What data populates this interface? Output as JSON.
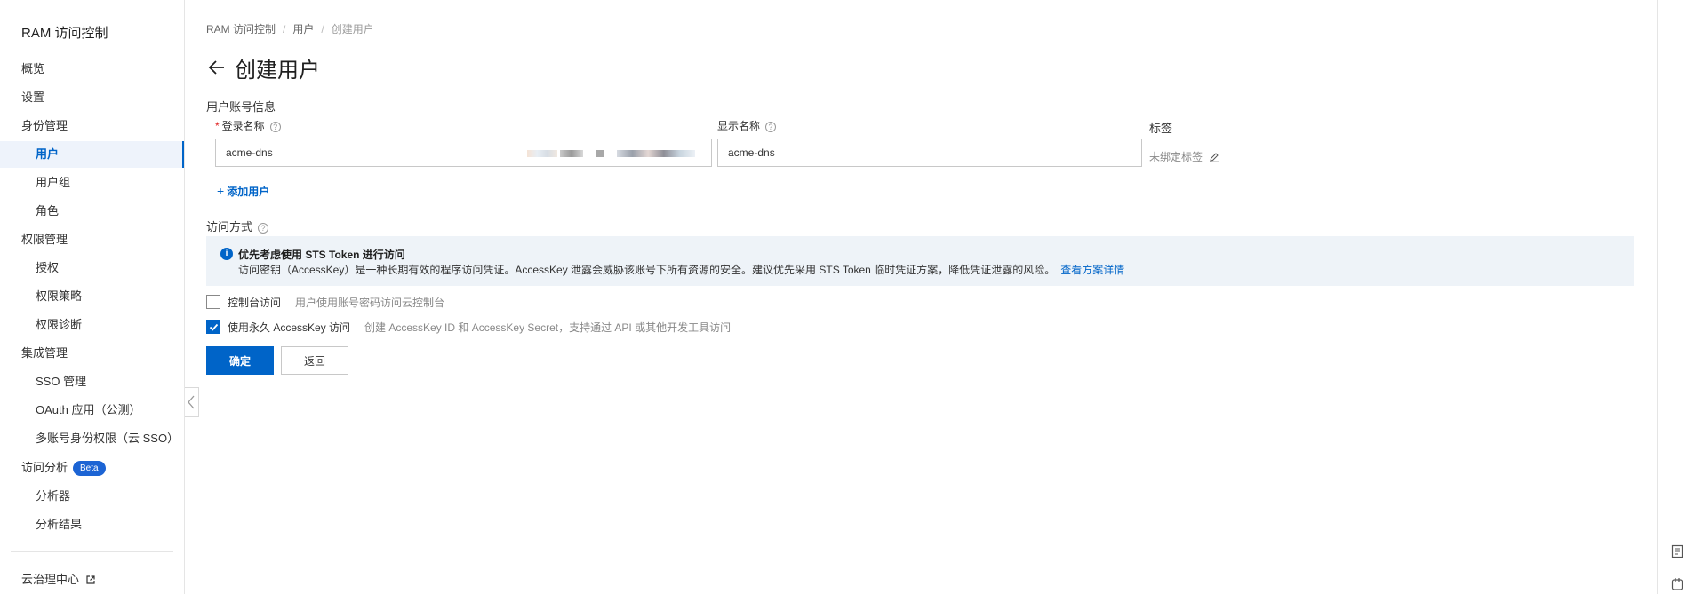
{
  "sidebar": {
    "title": "RAM 访问控制",
    "items": {
      "overview": "概览",
      "settings": "设置",
      "identity": "身份管理",
      "users": "用户",
      "user_groups": "用户组",
      "roles": "角色",
      "permissions": "权限管理",
      "grants": "授权",
      "policies": "权限策略",
      "diagnosis": "权限诊断",
      "integration": "集成管理",
      "sso": "SSO 管理",
      "oauth": "OAuth 应用（公测）",
      "multi_account": "多账号身份权限（云 SSO）",
      "access_analysis": "访问分析",
      "beta": "Beta",
      "analyzer": "分析器",
      "results": "分析结果",
      "governance": "云治理中心"
    }
  },
  "breadcrumb": [
    "RAM 访问控制",
    "用户",
    "创建用户"
  ],
  "page_title": "创建用户",
  "form": {
    "account_section": "用户账号信息",
    "login_name_label": "登录名称",
    "login_name_value": "acme-dns",
    "display_name_label": "显示名称",
    "display_name_value": "acme-dns",
    "tag_label": "标签",
    "tag_value": "未绑定标签",
    "add_user": "添加用户",
    "access_section": "访问方式"
  },
  "alert": {
    "title": "优先考虑使用 STS Token 进行访问",
    "body": "访问密钥（AccessKey）是一种长期有效的程序访问凭证。AccessKey 泄露会威胁该账号下所有资源的安全。建议优先采用 STS Token 临时凭证方案，降低凭证泄露的风险。",
    "link": "查看方案详情"
  },
  "options": [
    {
      "label": "控制台访问",
      "desc": "用户使用账号密码访问云控制台",
      "checked": false
    },
    {
      "label": "使用永久 AccessKey 访问",
      "desc": "创建 AccessKey ID 和 AccessKey Secret，支持通过 API 或其他开发工具访问",
      "checked": true
    }
  ],
  "buttons": {
    "confirm": "确定",
    "back": "返回"
  },
  "colors": {
    "primary": "#0064c8",
    "alert_bg": "#eef3f8",
    "required": "#e02020"
  }
}
